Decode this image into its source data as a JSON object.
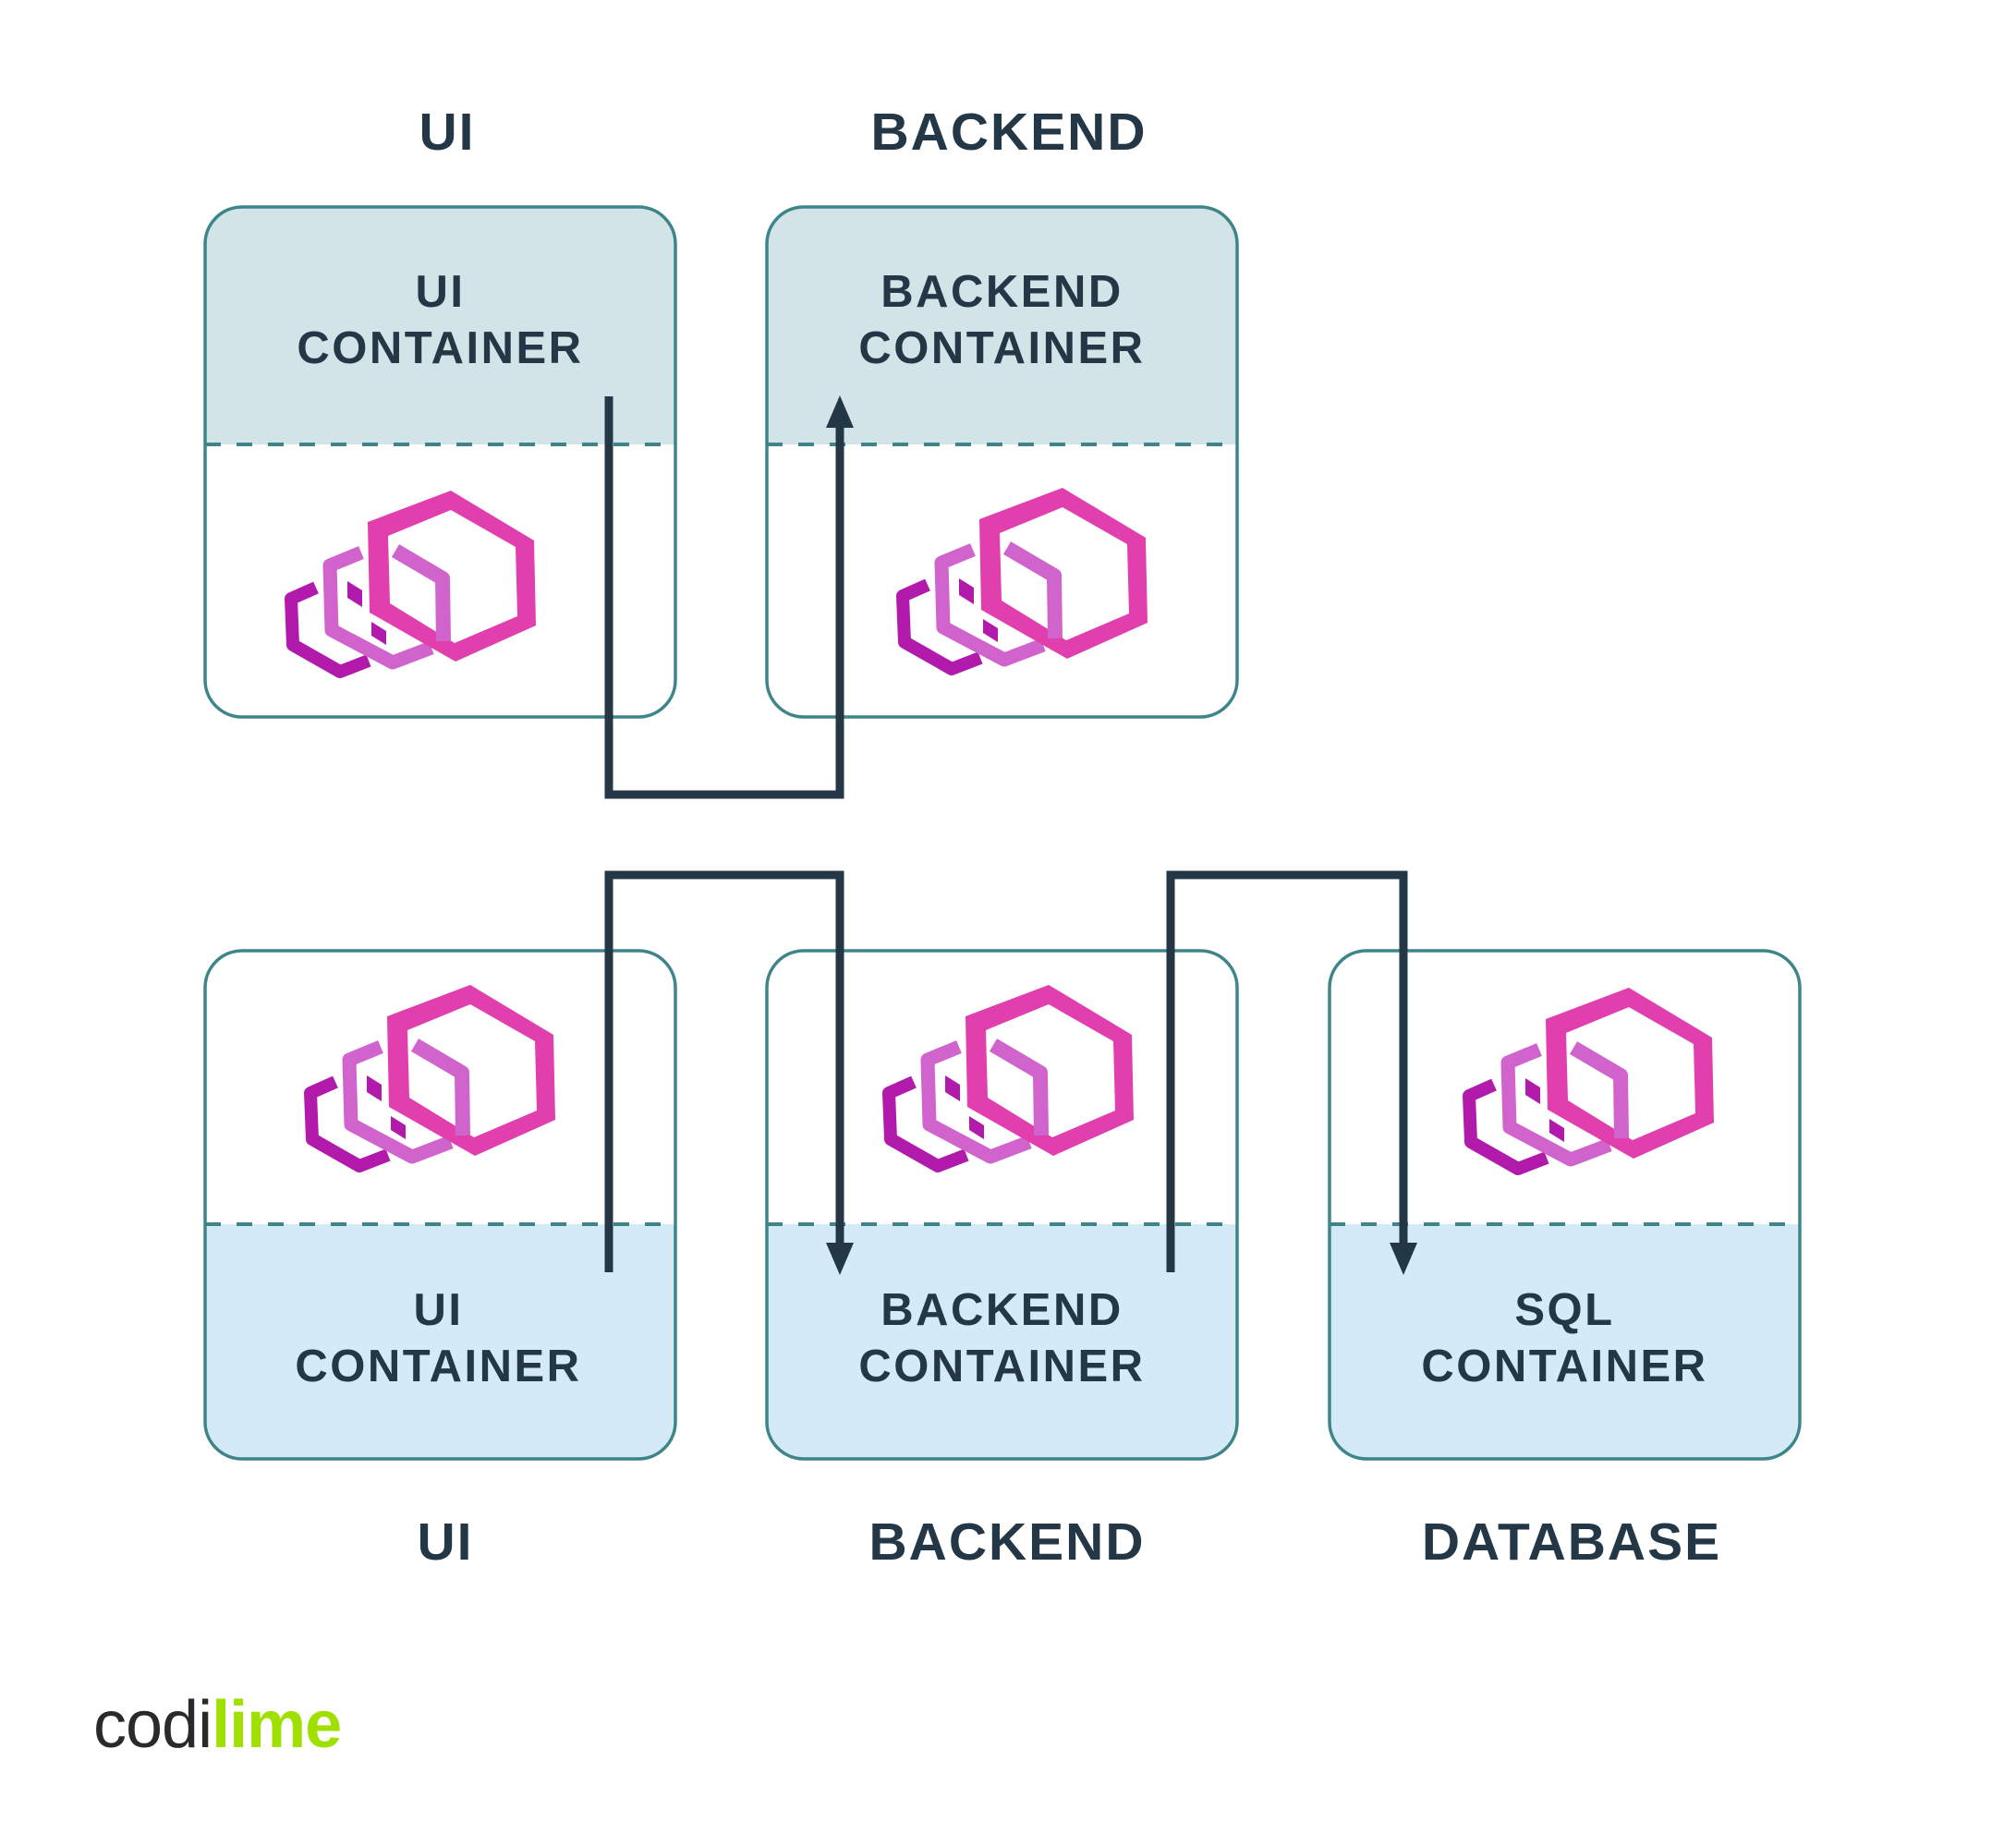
{
  "diagram": {
    "top_row": {
      "columns": [
        {
          "section_label": "UI",
          "container_label": [
            "UI",
            "CONTAINER"
          ]
        },
        {
          "section_label": "BACKEND",
          "container_label": [
            "BACKEND",
            "CONTAINER"
          ]
        }
      ]
    },
    "bottom_row": {
      "columns": [
        {
          "section_label": "UI",
          "container_label": [
            "UI",
            "CONTAINER"
          ]
        },
        {
          "section_label": "BACKEND",
          "container_label": [
            "BACKEND",
            "CONTAINER"
          ]
        },
        {
          "section_label": "DATABASE",
          "container_label": [
            "SQL",
            "CONTAINER"
          ]
        }
      ]
    },
    "connections": [
      {
        "from": "UI CONTAINER (top)",
        "to": "BACKEND CONTAINER (top)",
        "arrow": "end"
      },
      {
        "from": "UI CONTAINER (bottom)",
        "to": "BACKEND CONTAINER (bottom)",
        "arrow": "end"
      },
      {
        "from": "BACKEND CONTAINER (bottom)",
        "to": "SQL CONTAINER",
        "arrow": "end"
      }
    ],
    "icon": "envoy-proxy-logo"
  },
  "brand": {
    "part1": "codi",
    "part2": "lime"
  },
  "colors": {
    "text": "#243746",
    "box_border": "#3d8588",
    "top_container_fill": "#d3e4e9",
    "bottom_container_fill": "#d4ebf7",
    "connector": "#243746",
    "logo_pink": "#e03fad",
    "logo_light_purple": "#d063cc",
    "logo_dark_purple": "#b11aab",
    "brand_dark": "#2b2a28",
    "brand_green": "#9fe000"
  }
}
